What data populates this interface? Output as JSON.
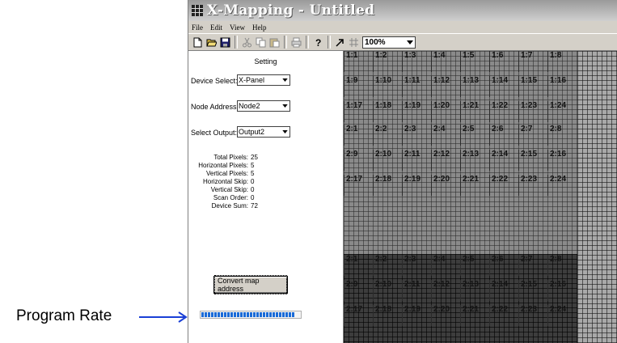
{
  "window": {
    "title": "X-Mapping - Untitled"
  },
  "menu": [
    "File",
    "Edit",
    "View",
    "Help"
  ],
  "toolbar": {
    "icons": [
      "new-icon",
      "open-icon",
      "save-icon",
      "cut-icon",
      "copy-icon",
      "paste-icon",
      "print-icon",
      "help-icon",
      "pointer-icon",
      "grid-icon"
    ],
    "zoom": "100%"
  },
  "panel": {
    "title": "Setting",
    "device_select": {
      "label": "Device Select:",
      "value": "X-Panel"
    },
    "node_address": {
      "label": "Node Address:",
      "value": "Node2"
    },
    "select_output": {
      "label": "Select Output:",
      "value": "Output2"
    },
    "stats": [
      {
        "label": "Total Pixels:",
        "value": "25"
      },
      {
        "label": "Horizontal Pixels:",
        "value": "5"
      },
      {
        "label": "Vertical Pixels:",
        "value": "5"
      },
      {
        "label": "Horizontal Skip:",
        "value": "0"
      },
      {
        "label": "Vertical Skip:",
        "value": "0"
      },
      {
        "label": "Scan Order:",
        "value": "0"
      },
      {
        "label": "Device Sum:",
        "value": "72"
      }
    ],
    "convert_button": "Convert map address",
    "progress": 0.95
  },
  "grid": {
    "blocks": [
      {
        "rows": [
          [
            "1:1",
            "1:2",
            "1:3",
            "1:4",
            "1:5",
            "1:6",
            "1:7",
            "1:8"
          ],
          [
            "1:9",
            "1:10",
            "1:11",
            "1:12",
            "1:13",
            "1:14",
            "1:15",
            "1:16"
          ],
          [
            "1:17",
            "1:18",
            "1:19",
            "1:20",
            "1:21",
            "1:22",
            "1:23",
            "1:24"
          ]
        ]
      },
      {
        "rows": [
          [
            "2:1",
            "2:2",
            "2:3",
            "2:4",
            "2:5",
            "2:6",
            "2:7",
            "2:8"
          ],
          [
            "2:9",
            "2:10",
            "2:11",
            "2:12",
            "2:13",
            "2:14",
            "2:15",
            "2:16"
          ],
          [
            "2:17",
            "2:18",
            "2:19",
            "2:20",
            "2:21",
            "2:22",
            "2:23",
            "2:24"
          ]
        ]
      },
      {
        "rows": [
          [
            "2:1",
            "2:2",
            "2:3",
            "2:4",
            "2:5",
            "2:6",
            "2:7",
            "2:8"
          ],
          [
            "2:9",
            "2:10",
            "2:11",
            "2:12",
            "2:13",
            "2:14",
            "2:15",
            "2:16"
          ],
          [
            "2:17",
            "2:18",
            "2:19",
            "2:20",
            "2:21",
            "2:22",
            "2:23",
            "2:24"
          ]
        ]
      }
    ]
  },
  "annotation": {
    "label": "Program Rate"
  },
  "colors": {
    "arrow": "#1a3fd6",
    "progress": "#1a6bd8"
  }
}
